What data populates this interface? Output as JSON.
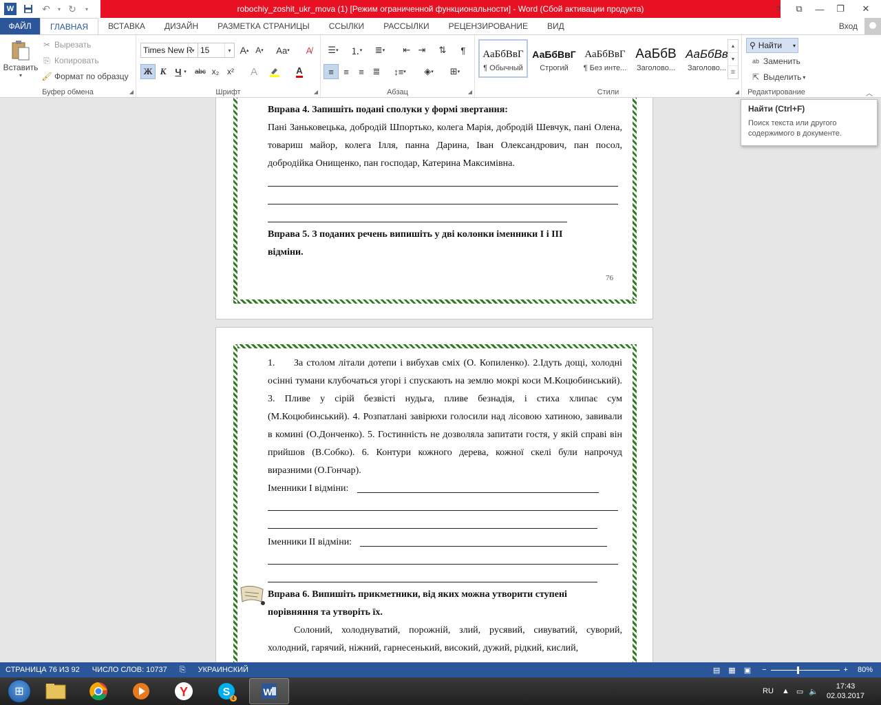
{
  "window": {
    "title": "robochiy_zoshit_ukr_mova (1) [Режим ограниченной функциональности] -  Word (Сбой активации продукта)"
  },
  "tabs": [
    "ФАЙЛ",
    "ГЛАВНАЯ",
    "ВСТАВКА",
    "ДИЗАЙН",
    "РАЗМЕТКА СТРАНИЦЫ",
    "ССЫЛКИ",
    "РАССЫЛКИ",
    "РЕЦЕНЗИРОВАНИЕ",
    "ВИД"
  ],
  "signin": "Вход",
  "clipboard": {
    "paste": "Вставить",
    "cut": "Вырезать",
    "copy": "Копировать",
    "format_painter": "Формат по образцу",
    "label": "Буфер обмена"
  },
  "font": {
    "name": "Times New R",
    "size": "15",
    "bold": "Ж",
    "italic": "К",
    "underline": "Ч",
    "strike": "abc",
    "sub": "x₂",
    "sup": "x²",
    "aa": "Aa",
    "label": "Шрифт"
  },
  "paragraph": {
    "label": "Абзац"
  },
  "styles": {
    "label": "Стили",
    "items": [
      {
        "sample": "АаБбВвГ",
        "name": "¶ Обычный"
      },
      {
        "sample": "АаБбВвГ",
        "name": "Строгий"
      },
      {
        "sample": "АаБбВвГ",
        "name": "¶ Без инте..."
      },
      {
        "sample": "АаБбВ",
        "name": "Заголово..."
      },
      {
        "sample": "АаБбВв",
        "name": "Заголово..."
      }
    ]
  },
  "editing": {
    "find": "Найти",
    "replace": "Заменить",
    "select": "Выделить",
    "label": "Редактирование"
  },
  "tooltip": {
    "title": "Найти (Ctrl+F)",
    "body": "Поиск текста или другого содержимого в документе."
  },
  "doc": {
    "ex4_title": "Вправа 4. Запишіть подані сполуки у формі звертання:",
    "ex4_text": "Пані Заньковецька, добродій Шпортько, колега Марія, добродій Шевчук, пані Олена, товариш майор, колега Ілля, панна Дарина, Іван Олександрович, пан посол, добродійка Онищенко,  пан господар, Катерина Максимівна.",
    "ex5_title": "Вправа 5.  З поданих речень випишіть у дві колонки іменники І і ІІІ відміни.",
    "page_number": "76",
    "list_num": "1.",
    "ex5_text": "За столом літали дотепи і вибухав сміх (О. Копиленко). 2.Ідуть дощі, холодні осінні тумани клубочаться угорі і спускають на землю мокрі коси М.Коцюбинський). 3. Пливе у сірій безвісті нудьга, пливе безнадія, і стиха хлипає сум (М.Коцюбинський). 4. Розпатлані завірюхи голосили над лісовою хатиною, завивали в комині (О.Донченко). 5. Гостинність не дозволяла запитати гостя, у якій справі він прийшов (В.Собко). 6. Контури кожного дерева, кожної скелі були напрочуд виразними (О.Гончар).",
    "nouns1": "Іменники І відміни:",
    "nouns2": "Іменники ІІ відміни:",
    "ex6_title": "Вправа 6. Випишіть прикметники, від яких можна утворити ступені порівняння та утворіть їх.",
    "ex6_text": "Солоний, холоднуватий, порожній, злий, русявий, сивуватий, суворий, холодний, гарячий, ніжний, гарнесенький, високий, дужий, рідкий, кислий,"
  },
  "status": {
    "page": "СТРАНИЦА 76 ИЗ 92",
    "words": "ЧИСЛО СЛОВ: 10737",
    "lang": "УКРАИНСКИЙ",
    "zoom": "80%"
  },
  "taskbar": {
    "lang": "RU",
    "time": "17:43",
    "date": "02.03.2017",
    "skype_badge": "4"
  }
}
